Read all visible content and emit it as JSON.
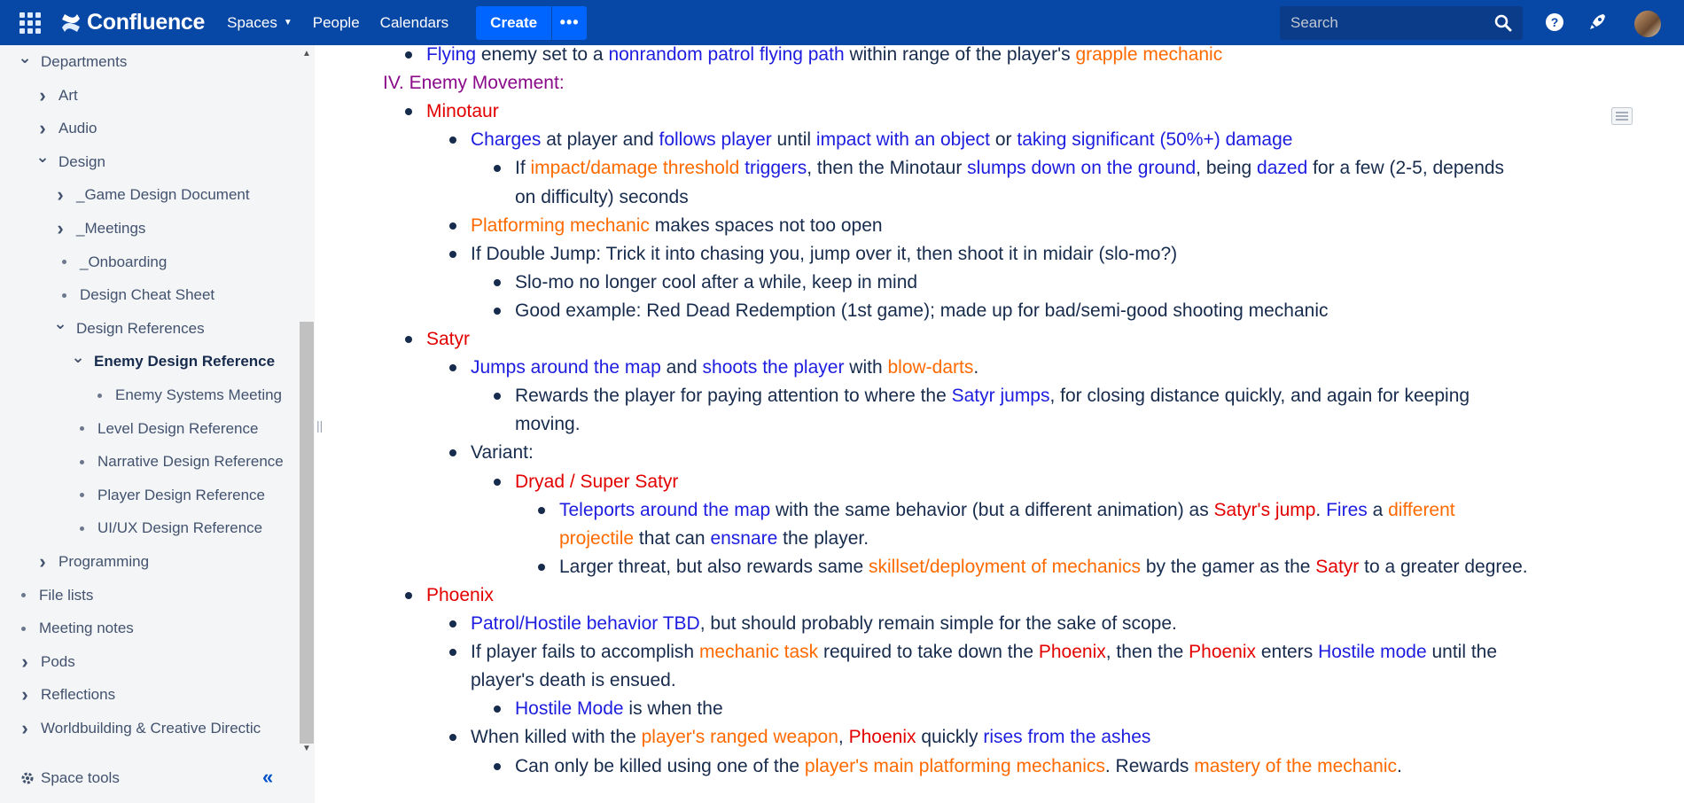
{
  "topbar": {
    "app_name": "Confluence",
    "nav": [
      "Spaces",
      "People",
      "Calendars"
    ],
    "create": "Create",
    "more": "•••",
    "search_placeholder": "Search"
  },
  "sidebar": {
    "items": [
      {
        "label": "Departments",
        "icon": "chevron-down-icon",
        "level": 0,
        "type": "expanded"
      },
      {
        "label": "Art",
        "icon": "chevron-right-icon",
        "level": 1,
        "type": "collapsed"
      },
      {
        "label": "Audio",
        "icon": "chevron-right-icon",
        "level": 1,
        "type": "collapsed"
      },
      {
        "label": "Design",
        "icon": "chevron-down-icon",
        "level": 1,
        "type": "expanded"
      },
      {
        "label": "_Game Design Document",
        "icon": "chevron-right-icon",
        "level": 2,
        "type": "collapsed"
      },
      {
        "label": "_Meetings",
        "icon": "chevron-right-icon",
        "level": 2,
        "type": "collapsed"
      },
      {
        "label": "_Onboarding",
        "icon": "bullet",
        "level": 2,
        "type": "leaf"
      },
      {
        "label": "Design Cheat Sheet",
        "icon": "bullet",
        "level": 2,
        "type": "leaf"
      },
      {
        "label": "Design References",
        "icon": "chevron-down-icon",
        "level": 2,
        "type": "expanded"
      },
      {
        "label": "Enemy Design Reference",
        "icon": "chevron-down-icon",
        "level": 3,
        "type": "expanded",
        "selected": true
      },
      {
        "label": "Enemy Systems Meeting",
        "icon": "bullet",
        "level": 4,
        "type": "leaf"
      },
      {
        "label": "Level Design Reference",
        "icon": "bullet",
        "level": 3,
        "type": "leaf"
      },
      {
        "label": "Narrative Design Reference",
        "icon": "bullet",
        "level": 3,
        "type": "leaf"
      },
      {
        "label": "Player Design Reference",
        "icon": "bullet",
        "level": 3,
        "type": "leaf"
      },
      {
        "label": "UI/UX Design Reference",
        "icon": "bullet",
        "level": 3,
        "type": "leaf"
      },
      {
        "label": "Programming",
        "icon": "chevron-right-icon",
        "level": 1,
        "type": "collapsed"
      },
      {
        "label": "File lists",
        "icon": "bullet",
        "level": 0,
        "type": "leaf"
      },
      {
        "label": "Meeting notes",
        "icon": "bullet",
        "level": 0,
        "type": "leaf"
      },
      {
        "label": "Pods",
        "icon": "chevron-right-icon",
        "level": 0,
        "type": "collapsed"
      },
      {
        "label": "Reflections",
        "icon": "chevron-right-icon",
        "level": 0,
        "type": "collapsed"
      },
      {
        "label": "Worldbuilding & Creative Directic",
        "icon": "chevron-right-icon",
        "level": 0,
        "type": "collapsed"
      }
    ],
    "space_tools": "Space tools"
  },
  "colors": {
    "blue": "#1d1de0",
    "orange": "#ff6a00",
    "red": "#e30000",
    "purple": "#8a0a8a",
    "header": "#0747a6"
  },
  "content": {
    "lines": [
      {
        "bullet": true,
        "segs": [
          [
            "Flying",
            "b"
          ],
          [
            " enemy set to a ",
            ""
          ],
          [
            "nonrandom patrol flying path",
            "b"
          ],
          [
            " within range of the player's ",
            ""
          ],
          [
            "grapple mechanic",
            "o"
          ]
        ]
      },
      {
        "bullet": false,
        "segs": [
          [
            "IV. Enemy Movement:",
            "p"
          ]
        ]
      },
      {
        "bullet": true,
        "segs": [
          [
            "Minotaur",
            "r"
          ]
        ]
      },
      {
        "bullet": true,
        "segs": [
          [
            "Charges",
            "b"
          ],
          [
            " at player and ",
            ""
          ],
          [
            "follows player",
            "b"
          ],
          [
            " until ",
            ""
          ],
          [
            "impact with an object",
            "b"
          ],
          [
            " or ",
            ""
          ],
          [
            "taking significant (50%+) damage",
            "b"
          ]
        ]
      },
      {
        "bullet": true,
        "segs": [
          [
            "If ",
            ""
          ],
          [
            "impact/damage threshold",
            "o"
          ],
          [
            " ",
            ""
          ],
          [
            "triggers",
            "b"
          ],
          [
            ", then the Minotaur ",
            ""
          ],
          [
            "slumps down on the ground",
            "b"
          ],
          [
            ", being ",
            ""
          ],
          [
            "dazed",
            "b"
          ],
          [
            " for a few (2-5, depends",
            ""
          ]
        ]
      },
      {
        "bullet": false,
        "segs": [
          [
            "on difficulty) seconds",
            ""
          ]
        ]
      },
      {
        "bullet": true,
        "segs": [
          [
            "Platforming mechanic",
            "o"
          ],
          [
            " makes spaces not too open",
            ""
          ]
        ]
      },
      {
        "bullet": true,
        "segs": [
          [
            "If Double Jump: Trick it into chasing you, jump over it, then shoot it in midair (slo-mo?)",
            ""
          ]
        ]
      },
      {
        "bullet": true,
        "segs": [
          [
            "Slo-mo no longer cool after a while, keep in mind",
            ""
          ]
        ]
      },
      {
        "bullet": true,
        "segs": [
          [
            "Good example: Red Dead Redemption (1st game); made up for bad/semi-good shooting mechanic",
            ""
          ]
        ]
      },
      {
        "bullet": true,
        "segs": [
          [
            "Satyr",
            "r"
          ]
        ]
      },
      {
        "bullet": true,
        "segs": [
          [
            "Jumps around the map",
            "b"
          ],
          [
            " and ",
            ""
          ],
          [
            "shoots the player",
            "b"
          ],
          [
            " with ",
            ""
          ],
          [
            "blow-darts",
            "o"
          ],
          [
            ".",
            ""
          ]
        ]
      },
      {
        "bullet": true,
        "segs": [
          [
            "Rewards the player for paying attention to where the ",
            ""
          ],
          [
            "Satyr jumps",
            "b"
          ],
          [
            ", for closing distance quickly, and again for keeping",
            ""
          ]
        ]
      },
      {
        "bullet": false,
        "segs": [
          [
            "moving.",
            ""
          ]
        ]
      },
      {
        "bullet": true,
        "segs": [
          [
            "Variant:",
            ""
          ]
        ]
      },
      {
        "bullet": true,
        "segs": [
          [
            "Dryad / Super Satyr",
            "r"
          ]
        ]
      },
      {
        "bullet": true,
        "segs": [
          [
            "Teleports around the map",
            "b"
          ],
          [
            " with the same behavior (but a different animation) as ",
            ""
          ],
          [
            "Satyr's jump",
            "r"
          ],
          [
            ". ",
            ""
          ],
          [
            "Fires",
            "b"
          ],
          [
            " a ",
            ""
          ],
          [
            "different",
            "o"
          ]
        ]
      },
      {
        "bullet": false,
        "segs": [
          [
            "projectile",
            "o"
          ],
          [
            " that can ",
            ""
          ],
          [
            "ensnare",
            "b"
          ],
          [
            " the player.",
            ""
          ]
        ]
      },
      {
        "bullet": true,
        "segs": [
          [
            "Larger threat, but also rewards same ",
            ""
          ],
          [
            "skillset/deployment of mechanics",
            "o"
          ],
          [
            " by the gamer as the ",
            ""
          ],
          [
            "Satyr",
            "r"
          ],
          [
            " to a greater degree.",
            ""
          ]
        ]
      },
      {
        "bullet": true,
        "segs": [
          [
            "Phoenix",
            "r"
          ]
        ]
      },
      {
        "bullet": true,
        "segs": [
          [
            "Patrol/Hostile behavior TBD",
            "b"
          ],
          [
            ", but should probably remain simple for the sake of scope.",
            ""
          ]
        ]
      },
      {
        "bullet": true,
        "segs": [
          [
            "If player fails to accomplish ",
            ""
          ],
          [
            "mechanic task",
            "o"
          ],
          [
            " required to take down the ",
            ""
          ],
          [
            "Phoenix",
            "r"
          ],
          [
            ", then the ",
            ""
          ],
          [
            "Phoenix",
            "r"
          ],
          [
            " enters ",
            ""
          ],
          [
            "Hostile mode",
            "b"
          ],
          [
            " until the",
            ""
          ]
        ]
      },
      {
        "bullet": false,
        "segs": [
          [
            "player's death is ensued.",
            ""
          ]
        ]
      },
      {
        "bullet": true,
        "segs": [
          [
            "Hostile Mode",
            "b"
          ],
          [
            " is when the",
            ""
          ]
        ]
      },
      {
        "bullet": true,
        "segs": [
          [
            "When killed with the ",
            ""
          ],
          [
            "player's ranged weapon",
            "o"
          ],
          [
            ", ",
            ""
          ],
          [
            "Phoenix",
            "r"
          ],
          [
            " quickly ",
            ""
          ],
          [
            "rises from the ashes",
            "b"
          ]
        ]
      },
      {
        "bullet": true,
        "segs": [
          [
            "Can only be killed using one of the ",
            ""
          ],
          [
            "player's main platforming mechanics",
            "o"
          ],
          [
            ". Rewards ",
            ""
          ],
          [
            "mastery of the mechanic",
            "o"
          ],
          [
            ".",
            ""
          ]
        ]
      }
    ]
  }
}
